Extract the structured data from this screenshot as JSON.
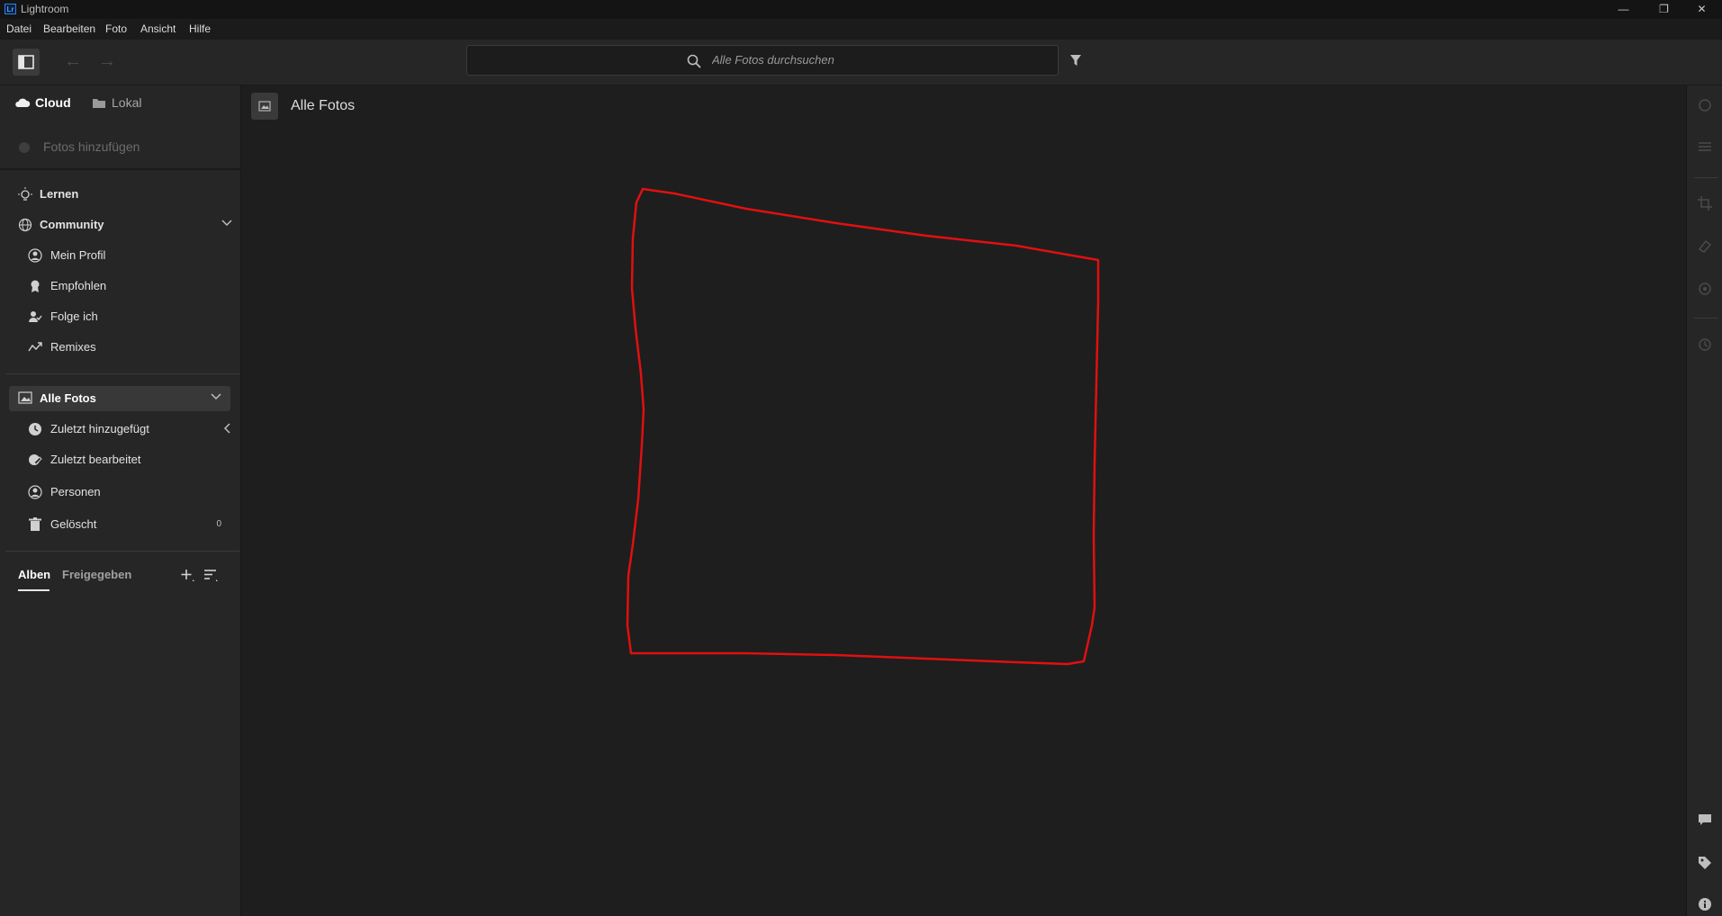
{
  "window": {
    "logo_text": "Lr",
    "title": "Lightroom",
    "minimize": "—",
    "maximize": "❐",
    "close": "✕"
  },
  "menu": [
    "Datei",
    "Bearbeiten",
    "Foto",
    "Ansicht",
    "Hilfe"
  ],
  "toolbar": {
    "back_glyph": "←",
    "forward_glyph": "→"
  },
  "search": {
    "placeholder": "Alle Fotos durchsuchen",
    "value": ""
  },
  "sidebar": {
    "tab_cloud": "Cloud",
    "tab_local": "Lokal",
    "add_photos": "Fotos hinzufügen",
    "learn": "Lernen",
    "community": "Community",
    "community_items": [
      "Mein Profil",
      "Empfohlen",
      "Folge ich",
      "Remixes"
    ],
    "all_photos": "Alle Fotos",
    "photo_items": [
      "Zuletzt hinzugefügt",
      "Zuletzt bearbeitet",
      "Personen",
      "Gelöscht"
    ],
    "deleted_count": "0",
    "tab_albums": "Alben",
    "tab_shared": "Freigegeben"
  },
  "main": {
    "title": "Alle Fotos"
  },
  "annotation": {
    "color": "#e01010",
    "shape": "hand-drawn-quadrilateral"
  },
  "colors": {
    "accent_red": "#e01010",
    "selected_row": "#383838",
    "panel": "#262626",
    "canvas": "#1e1e1e"
  }
}
